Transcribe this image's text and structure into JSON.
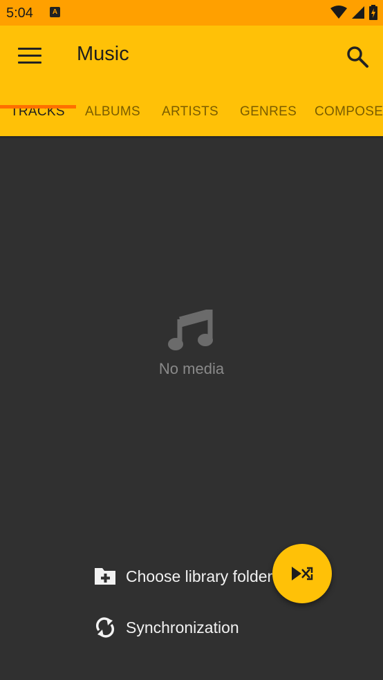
{
  "status_bar": {
    "time": "5:04",
    "notification_glyph": "A"
  },
  "app_bar": {
    "title": "Music",
    "menu_icon": "menu-icon",
    "search_icon": "search-icon"
  },
  "tabs": [
    {
      "label": "TRACKS",
      "active": true
    },
    {
      "label": "ALBUMS",
      "active": false
    },
    {
      "label": "ARTISTS",
      "active": false
    },
    {
      "label": "GENRES",
      "active": false
    },
    {
      "label": "COMPOSERS",
      "active": false
    }
  ],
  "empty_state": {
    "icon": "music-note-icon",
    "text": "No media"
  },
  "actions": {
    "choose_folder": {
      "label": "Choose library folder",
      "icon": "folder-add-icon"
    },
    "sync": {
      "label": "Synchronization",
      "icon": "sync-icon"
    }
  },
  "fab": {
    "icon": "shuffle-play-icon"
  },
  "colors": {
    "status_bar": "#FFA000",
    "app_bar": "#FFC107",
    "tab_indicator": "#FF6F00",
    "background": "#303030"
  }
}
